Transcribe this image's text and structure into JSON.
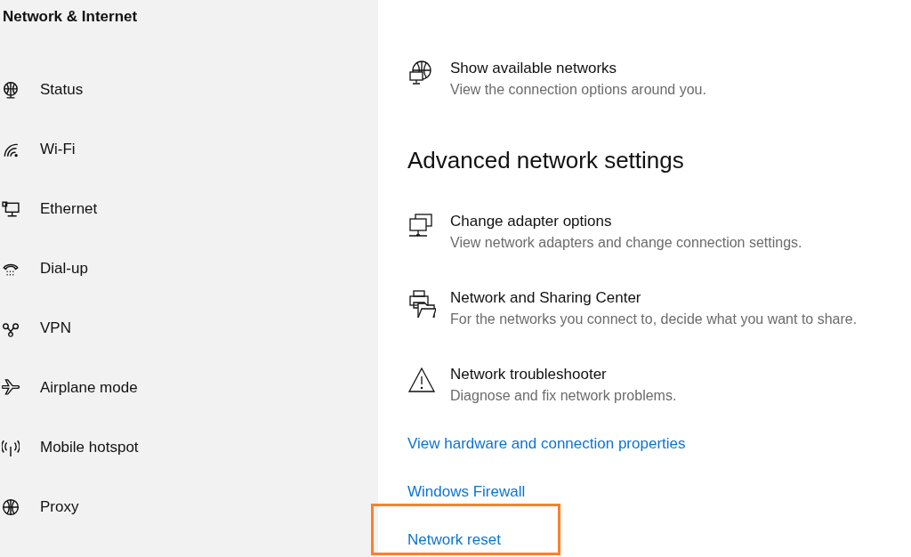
{
  "sidebar": {
    "title": "Network & Internet",
    "items": [
      {
        "kind": "status",
        "label": "Status"
      },
      {
        "kind": "wifi",
        "label": "Wi-Fi"
      },
      {
        "kind": "ethernet",
        "label": "Ethernet"
      },
      {
        "kind": "dialup",
        "label": "Dial-up"
      },
      {
        "kind": "vpn",
        "label": "VPN"
      },
      {
        "kind": "airplane",
        "label": "Airplane mode"
      },
      {
        "kind": "hotspot",
        "label": "Mobile hotspot"
      },
      {
        "kind": "proxy",
        "label": "Proxy"
      }
    ]
  },
  "top_option": {
    "kind": "networks",
    "title": "Show available networks",
    "description": "View the connection options around you."
  },
  "section": {
    "heading": "Advanced network settings",
    "options": [
      {
        "kind": "adapter",
        "title": "Change adapter options",
        "description": "View network adapters and change connection settings."
      },
      {
        "kind": "sharing",
        "title": "Network and Sharing Center",
        "description": "For the networks you connect to, decide what you want to share."
      },
      {
        "kind": "warning",
        "title": "Network troubleshooter",
        "description": "Diagnose and fix network problems."
      }
    ],
    "links": [
      {
        "label": "View hardware and connection properties",
        "highlighted": false
      },
      {
        "label": "Windows Firewall",
        "highlighted": false
      },
      {
        "label": "Network reset",
        "highlighted": true
      }
    ]
  }
}
